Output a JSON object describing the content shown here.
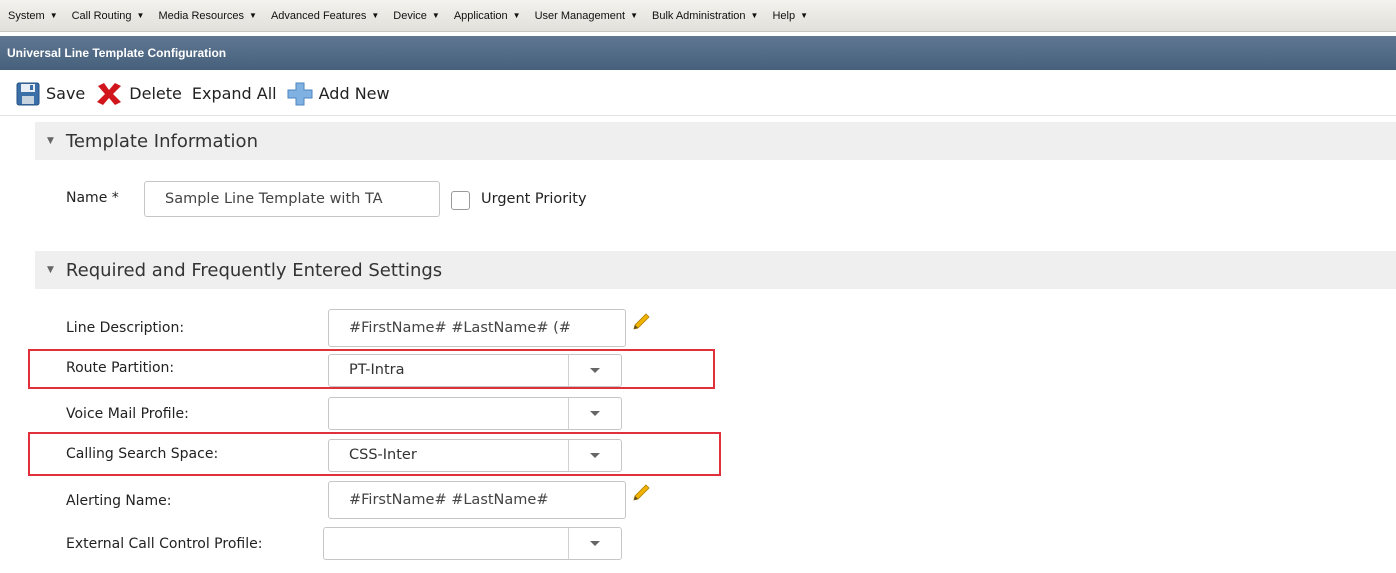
{
  "menu": {
    "items": [
      {
        "label": "System"
      },
      {
        "label": "Call Routing"
      },
      {
        "label": "Media Resources"
      },
      {
        "label": "Advanced Features"
      },
      {
        "label": "Device"
      },
      {
        "label": "Application"
      },
      {
        "label": "User Management"
      },
      {
        "label": "Bulk Administration"
      },
      {
        "label": "Help"
      }
    ]
  },
  "window": {
    "title": "Universal Line Template Configuration"
  },
  "toolbar": {
    "save_label": "Save",
    "delete_label": "Delete",
    "expand_all_label": "Expand All",
    "add_new_label": "Add New"
  },
  "template_info": {
    "section_title": "Template Information",
    "name_label": "Name *",
    "name_value": "Sample Line Template with TA",
    "urgent_priority_label": "Urgent Priority",
    "urgent_priority_checked": false
  },
  "required": {
    "section_title": "Required and Frequently Entered Settings",
    "line_description_label": "Line Description:",
    "line_description_value": "#FirstName# #LastName# (#",
    "route_partition_label": "Route Partition:",
    "route_partition_value": "PT-Intra",
    "voice_mail_profile_label": "Voice Mail Profile:",
    "voice_mail_profile_value": "",
    "calling_search_space_label": "Calling Search Space:",
    "calling_search_space_value": "CSS-Inter",
    "alerting_name_label": "Alerting Name:",
    "alerting_name_value": "#FirstName# #LastName#",
    "external_call_control_label": "External Call Control Profile:",
    "external_call_control_value": ""
  },
  "colors": {
    "title_bar": "#4f6885",
    "highlight": "#e0303c",
    "section_bg": "#efefef"
  }
}
